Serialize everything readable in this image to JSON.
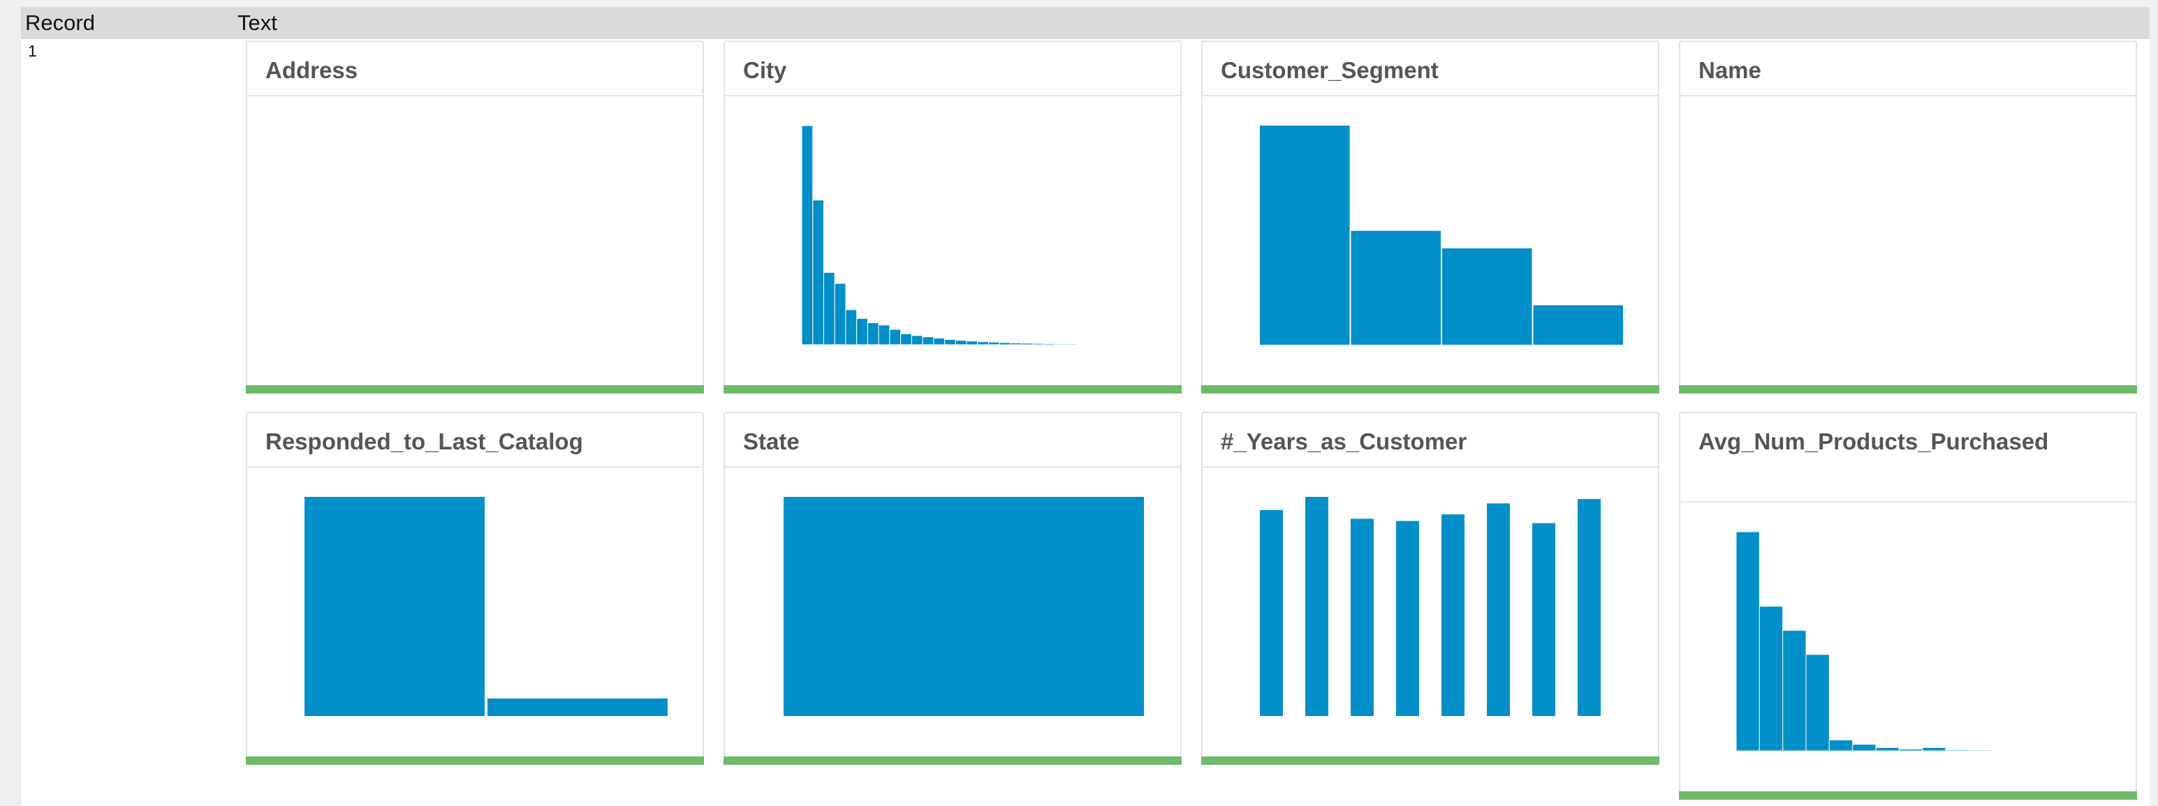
{
  "header": {
    "col_record": "Record",
    "col_text": "Text"
  },
  "record": {
    "number": "1"
  },
  "colors": {
    "bar": "#008fc8",
    "quality": "#6dbb6a"
  },
  "charts": [
    {
      "title": "Address"
    },
    {
      "title": "City"
    },
    {
      "title": "Customer_Segment"
    },
    {
      "title": "Name"
    },
    {
      "title": "Responded_to_Last_Catalog"
    },
    {
      "title": "State"
    },
    {
      "title": "#_Years_as_Customer"
    },
    {
      "title": "Avg_Num_Products_Purchased"
    }
  ],
  "chart_data": [
    {
      "type": "bar",
      "title": "Address",
      "values": []
    },
    {
      "type": "bar",
      "title": "City",
      "values": [
        100,
        66,
        33,
        28,
        16,
        12,
        10,
        9,
        7,
        5,
        4.2,
        3.6,
        3,
        2.4,
        2,
        1.7,
        1.4,
        1.2,
        1,
        0.8,
        0.7,
        0.6,
        0.5,
        0.4,
        0.4,
        0.3,
        0.3,
        0.2,
        0.2,
        0.2
      ]
    },
    {
      "type": "bar",
      "title": "Customer_Segment",
      "values": [
        100,
        52,
        44,
        18
      ]
    },
    {
      "type": "bar",
      "title": "Name",
      "values": []
    },
    {
      "type": "bar",
      "title": "Responded_to_Last_Catalog",
      "values": [
        100,
        8
      ]
    },
    {
      "type": "bar",
      "title": "State",
      "values": [
        100
      ]
    },
    {
      "type": "bar",
      "title": "#_Years_as_Customer",
      "values": [
        94,
        100,
        90,
        89,
        92,
        97,
        88,
        99
      ]
    },
    {
      "type": "bar",
      "title": "Avg_Num_Products_Purchased",
      "values": [
        100,
        66,
        55,
        44,
        5,
        3,
        1.5,
        0.8,
        1.5,
        0.5,
        0.4,
        0.3,
        0.2,
        0.2,
        0.2
      ]
    }
  ]
}
